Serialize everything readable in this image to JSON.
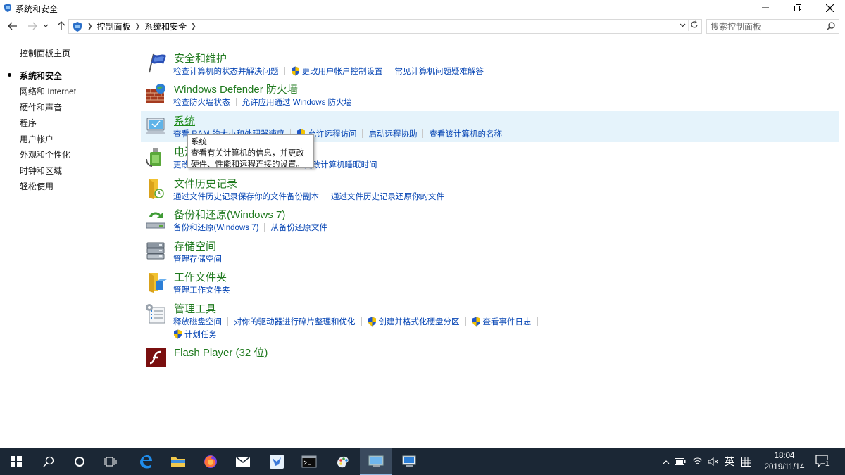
{
  "window": {
    "title": "系统和安全"
  },
  "address": {
    "crumbs": [
      "控制面板",
      "系统和安全"
    ],
    "search_placeholder": "搜索控制面板"
  },
  "leftnav": {
    "items": [
      {
        "label": "控制面板主页",
        "active": false
      },
      {
        "label": "系统和安全",
        "active": true
      },
      {
        "label": "网络和 Internet",
        "active": false
      },
      {
        "label": "硬件和声音",
        "active": false
      },
      {
        "label": "程序",
        "active": false
      },
      {
        "label": "用户帐户",
        "active": false
      },
      {
        "label": "外观和个性化",
        "active": false
      },
      {
        "label": "时钟和区域",
        "active": false
      },
      {
        "label": "轻松使用",
        "active": false
      }
    ]
  },
  "categories": [
    {
      "title": "安全和维护",
      "links": [
        {
          "label": "检查计算机的状态并解决问题",
          "shield": false
        },
        {
          "label": "更改用户帐户控制设置",
          "shield": true
        },
        {
          "label": "常见计算机问题疑难解答",
          "shield": false
        }
      ]
    },
    {
      "title": "Windows Defender 防火墙",
      "links": [
        {
          "label": "检查防火墙状态",
          "shield": false
        },
        {
          "label": "允许应用通过 Windows 防火墙",
          "shield": false
        }
      ]
    },
    {
      "title": "系统",
      "links": [
        {
          "label": "查看 RAM 的大小和处理器速度",
          "shield": false
        },
        {
          "label": "允许远程访问",
          "shield": true
        },
        {
          "label": "启动远程协助",
          "shield": false
        },
        {
          "label": "查看该计算机的名称",
          "shield": false
        }
      ]
    },
    {
      "title": "电源选项",
      "links": [
        {
          "label": "更改电池设置",
          "shield": false
        },
        {
          "label": "更改计算机睡眠时间",
          "shield": false
        }
      ]
    },
    {
      "title": "文件历史记录",
      "links": [
        {
          "label": "通过文件历史记录保存你的文件备份副本",
          "shield": false
        },
        {
          "label": "通过文件历史记录还原你的文件",
          "shield": false
        }
      ]
    },
    {
      "title": "备份和还原(Windows 7)",
      "links": [
        {
          "label": "备份和还原(Windows 7)",
          "shield": false
        },
        {
          "label": "从备份还原文件",
          "shield": false
        }
      ]
    },
    {
      "title": "存储空间",
      "links": [
        {
          "label": "管理存储空间",
          "shield": false
        }
      ]
    },
    {
      "title": "工作文件夹",
      "links": [
        {
          "label": "管理工作文件夹",
          "shield": false
        }
      ]
    },
    {
      "title": "管理工具",
      "links": [
        {
          "label": "释放磁盘空间",
          "shield": false
        },
        {
          "label": "对你的驱动器进行碎片整理和优化",
          "shield": false
        },
        {
          "label": "创建并格式化硬盘分区",
          "shield": true
        },
        {
          "label": "查看事件日志",
          "shield": true
        }
      ],
      "links2": [
        {
          "label": "计划任务",
          "shield": true
        }
      ]
    },
    {
      "title": "Flash Player (32 位)",
      "links": []
    }
  ],
  "tooltip": {
    "title": "系统",
    "body": "查看有关计算机的信息，并更改硬件、性能和远程连接的设置。"
  },
  "taskbar": {
    "ime": "英",
    "time": "18:04",
    "date": "2019/11/14",
    "notification_count": "1"
  }
}
